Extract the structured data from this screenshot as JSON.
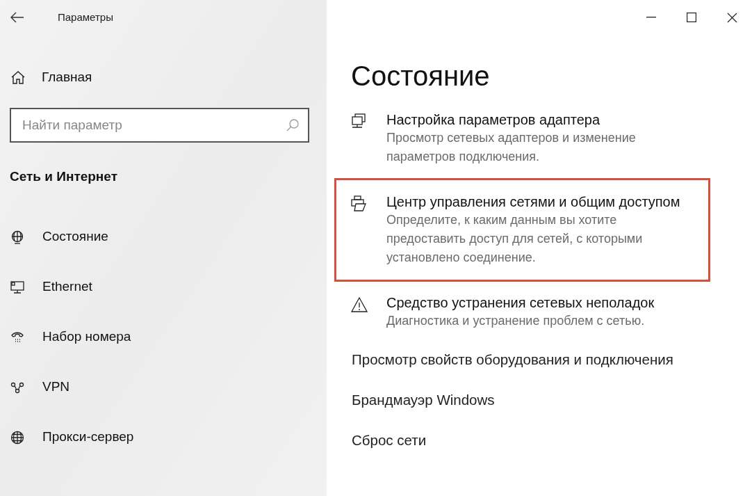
{
  "window": {
    "title": "Параметры"
  },
  "sidebar": {
    "home": "Главная",
    "search": {
      "placeholder": "Найти параметр"
    },
    "section_title": "Сеть и Интернет",
    "items": [
      {
        "label": "Состояние"
      },
      {
        "label": "Ethernet"
      },
      {
        "label": "Набор номера"
      },
      {
        "label": "VPN"
      },
      {
        "label": "Прокси-сервер"
      }
    ]
  },
  "main": {
    "heading": "Состояние",
    "settings": [
      {
        "title": "Настройка параметров адаптера",
        "description": "Просмотр сетевых адаптеров и изменение параметров подключения.",
        "highlighted": false
      },
      {
        "title": "Центр управления сетями и общим доступом",
        "description": "Определите, к каким данным вы хотите предоставить доступ для сетей, с которыми установлено соединение.",
        "highlighted": true
      },
      {
        "title": "Средство устранения сетевых неполадок",
        "description": "Диагностика и устранение проблем с сетью.",
        "highlighted": false
      }
    ],
    "links": [
      "Просмотр свойств оборудования и подключения",
      "Брандмауэр Windows",
      "Сброс сети"
    ]
  }
}
